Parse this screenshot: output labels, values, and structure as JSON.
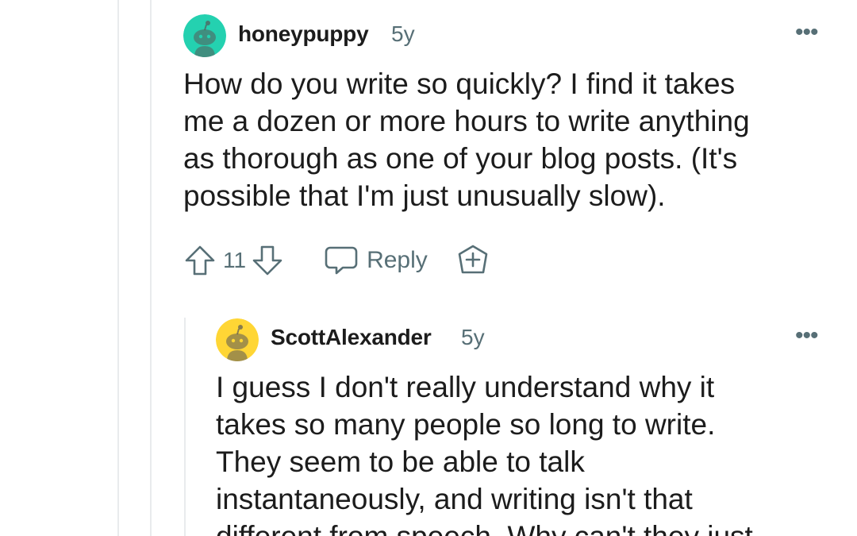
{
  "comments": [
    {
      "username": "honeypuppy",
      "timestamp": "5y",
      "avatar_color": "#24d1b0",
      "body_lines": [
        "How do you write so quickly? I find it takes",
        "me a dozen or more hours to write anything",
        "as thorough as one of your blog posts. (It's",
        "possible that I'm just unusually slow)."
      ],
      "vote_count": "11",
      "reply_label": "Reply",
      "icons": [
        "upvote-icon",
        "downvote-icon",
        "comment-bubble-icon",
        "award-icon",
        "more-options-icon"
      ]
    },
    {
      "username": "ScottAlexander",
      "timestamp": "5y",
      "avatar_color": "#ffd635",
      "body_lines": [
        "I guess I don't really understand why it",
        "takes so many people so long to write.",
        "They seem to be able to talk",
        "instantaneously, and writing isn't that",
        "different from speech. Why can't they just"
      ],
      "icons": [
        "more-options-icon"
      ]
    }
  ],
  "more_symbol": "•••"
}
